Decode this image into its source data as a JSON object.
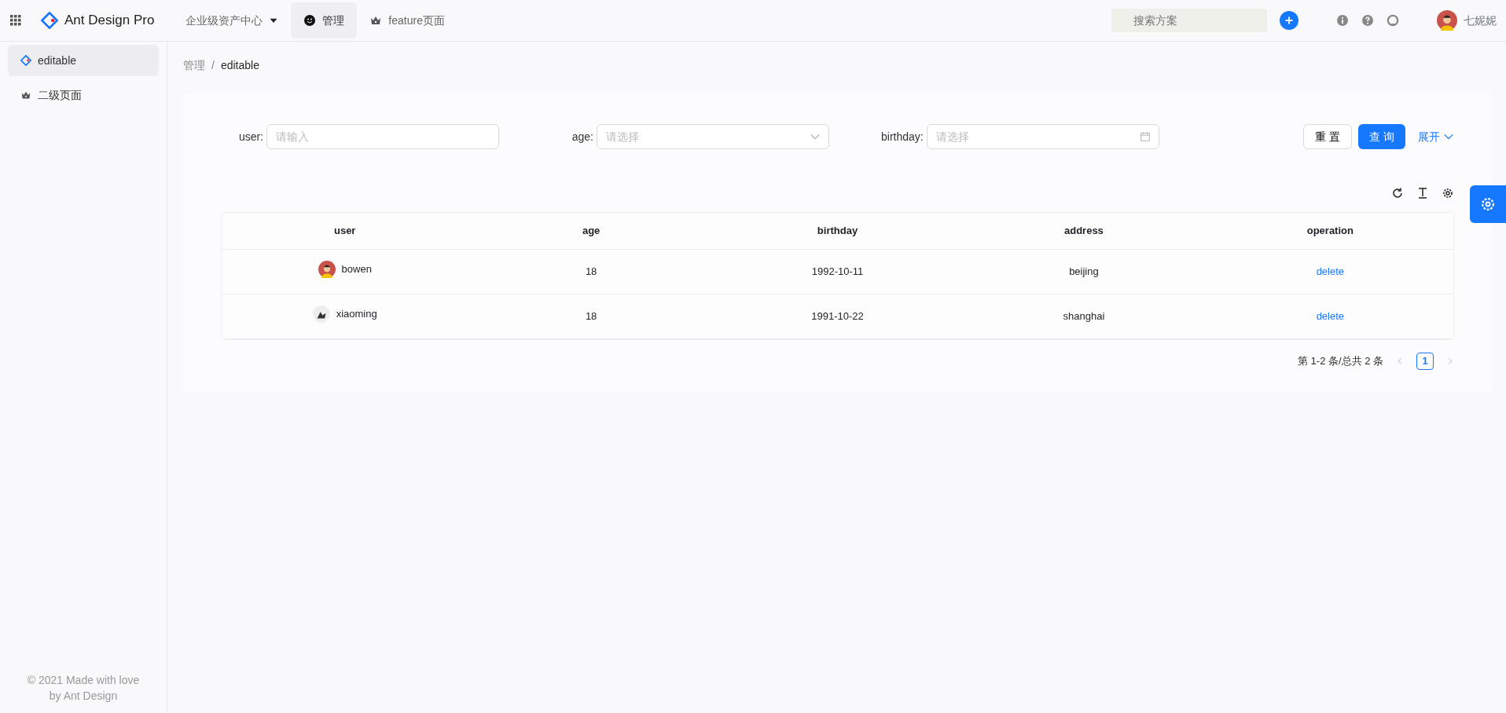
{
  "header": {
    "title": "Ant Design Pro",
    "menu": [
      {
        "label": "企业级资产中心",
        "kind": "dropdown",
        "selected": false
      },
      {
        "label": "管理",
        "kind": "smile",
        "selected": true
      },
      {
        "label": "feature页面",
        "kind": "crown",
        "selected": false
      }
    ],
    "search": {
      "placeholder": "搜索方案"
    },
    "user_name": "七妮妮"
  },
  "sidebar": {
    "items": [
      {
        "label": "editable",
        "kind": "logo",
        "selected": true
      },
      {
        "label": "二级页面",
        "kind": "crown",
        "selected": false
      }
    ],
    "footer": [
      "© 2021 Made with love",
      "by Ant Design"
    ]
  },
  "breadcrumb": {
    "items": [
      "管理",
      "editable"
    ],
    "separator": "/"
  },
  "filters": [
    {
      "label": "user:",
      "kind": "input",
      "placeholder": "请输入"
    },
    {
      "label": "age:",
      "kind": "select",
      "placeholder": "请选择"
    },
    {
      "label": "birthday:",
      "kind": "date",
      "placeholder": "请选择"
    }
  ],
  "filter_buttons": {
    "reset": "重 置",
    "query": "查 询",
    "expand": "展开"
  },
  "table": {
    "columns": [
      "user",
      "age",
      "birthday",
      "address",
      "operation"
    ],
    "rows": [
      {
        "user": "bowen",
        "age": "18",
        "birthday": "1992-10-11",
        "address": "beijing",
        "operation": "delete"
      },
      {
        "user": "xiaoming",
        "age": "18",
        "birthday": "1991-10-22",
        "address": "shanghai",
        "operation": "delete"
      }
    ]
  },
  "pagination": {
    "summary": "第 1-2 条/总共 2 条",
    "pages": [
      {
        "label": "1",
        "selected": true
      }
    ]
  }
}
